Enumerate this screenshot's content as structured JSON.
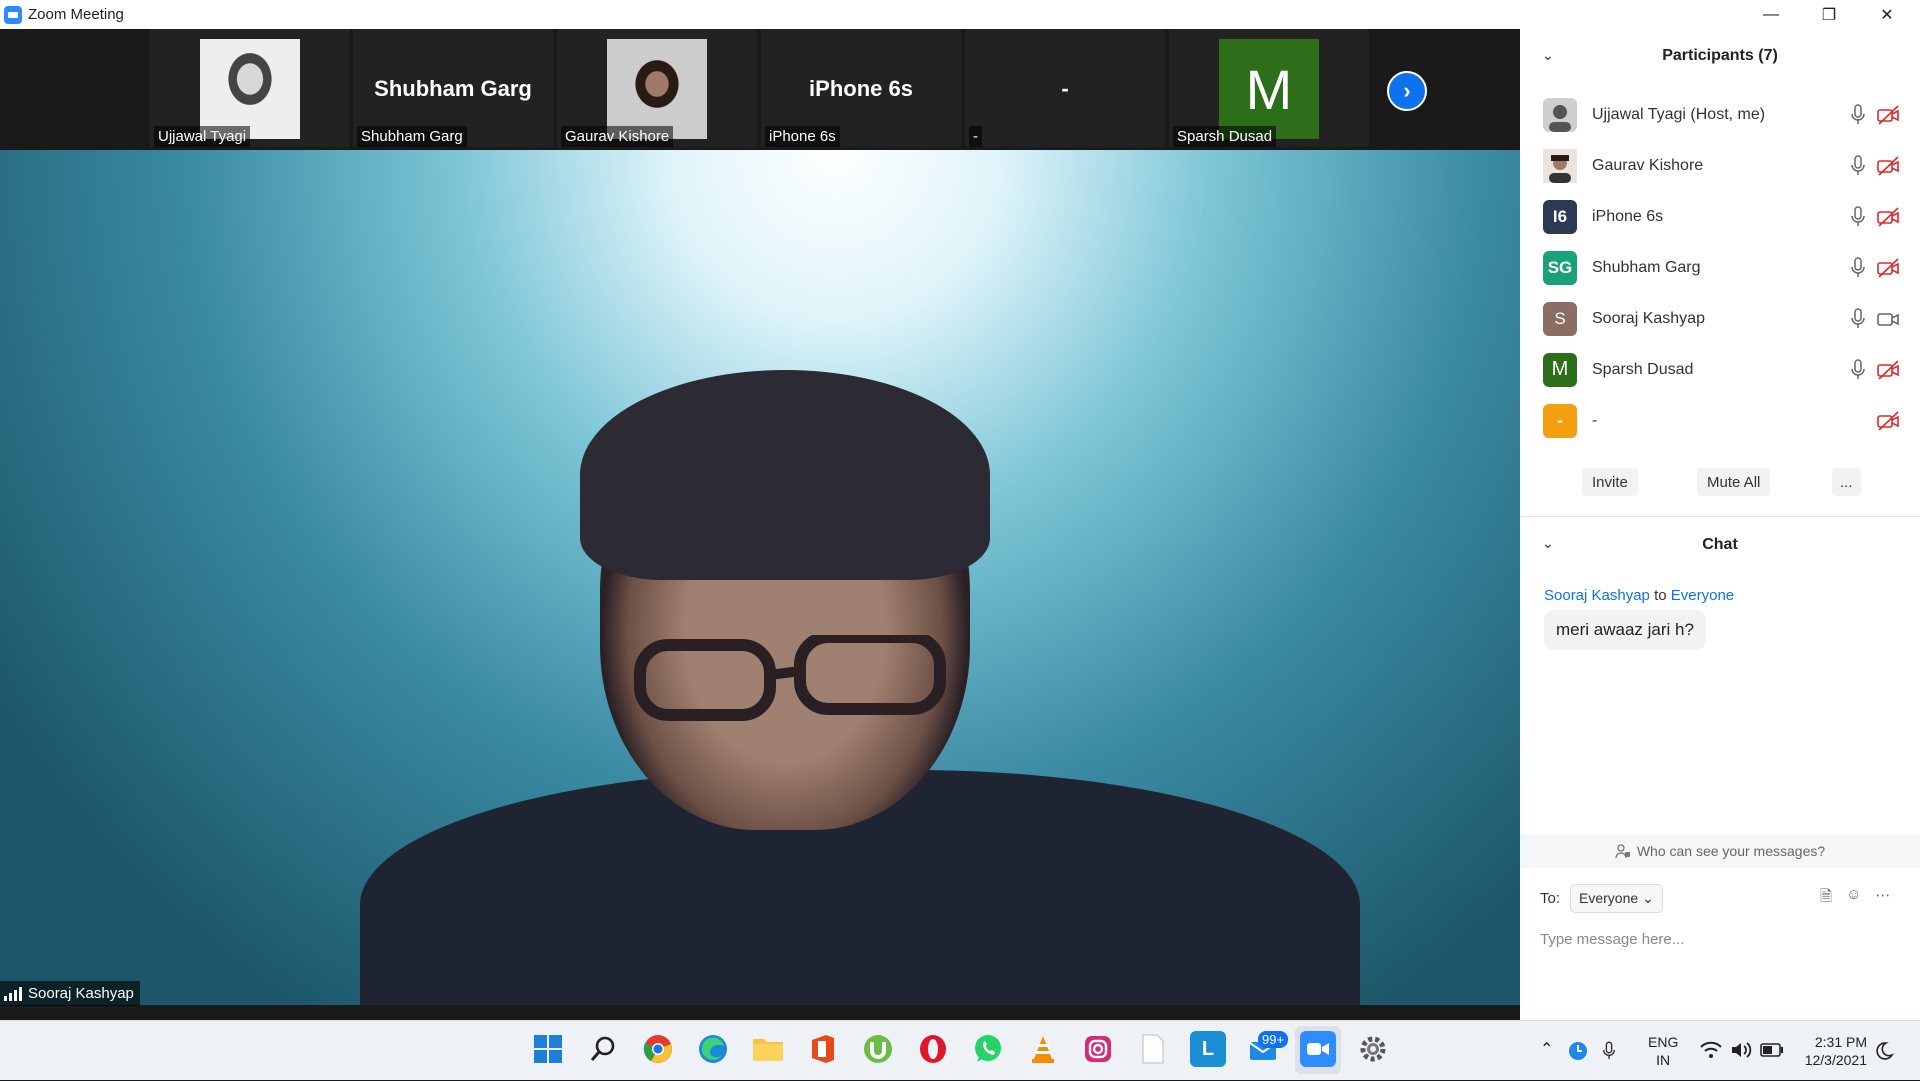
{
  "window": {
    "title": "Zoom Meeting"
  },
  "thumbnails": [
    {
      "label": "Ujjawal Tyagi",
      "big": ""
    },
    {
      "label": "Shubham Garg",
      "big": "Shubham Garg"
    },
    {
      "label": "Gaurav Kishore",
      "big": ""
    },
    {
      "label": "iPhone 6s",
      "big": "iPhone 6s"
    },
    {
      "label": "-",
      "big": "-"
    },
    {
      "label": "Sparsh Dusad",
      "big": "",
      "avatar_letter": "M"
    }
  ],
  "active_speaker": {
    "name": "Sooraj Kashyap"
  },
  "participants": {
    "title": "Participants (7)",
    "list": [
      {
        "name": "Ujjawal Tyagi (Host, me)",
        "avatar": "",
        "color": "#d9d9d9"
      },
      {
        "name": "Gaurav Kishore",
        "avatar": "",
        "color": "#8a6a5a"
      },
      {
        "name": "iPhone 6s",
        "avatar": "I6",
        "color": "#2b3a52"
      },
      {
        "name": "Shubham Garg",
        "avatar": "SG",
        "color": "#1aa17a"
      },
      {
        "name": "Sooraj Kashyap",
        "avatar": "S",
        "color": "#8a6d63"
      },
      {
        "name": "Sparsh Dusad",
        "avatar": "M",
        "color": "#2d6e1a"
      },
      {
        "name": "-",
        "avatar": "-",
        "color": "#f2a010"
      }
    ],
    "buttons": {
      "invite": "Invite",
      "mute_all": "Mute All",
      "more": "..."
    }
  },
  "chat": {
    "title": "Chat",
    "from": "Sooraj Kashyap",
    "to_word": "to",
    "to": "Everyone",
    "message": "meri awaaz jari h?",
    "visibility": "Who can see your messages?",
    "to_label": "To:",
    "recipient": "Everyone",
    "input_placeholder": "Type message here..."
  },
  "taskbar": {
    "badge": "99+",
    "lang_1": "ENG",
    "lang_2": "IN",
    "time": "2:31 PM",
    "date": "12/3/2021"
  }
}
